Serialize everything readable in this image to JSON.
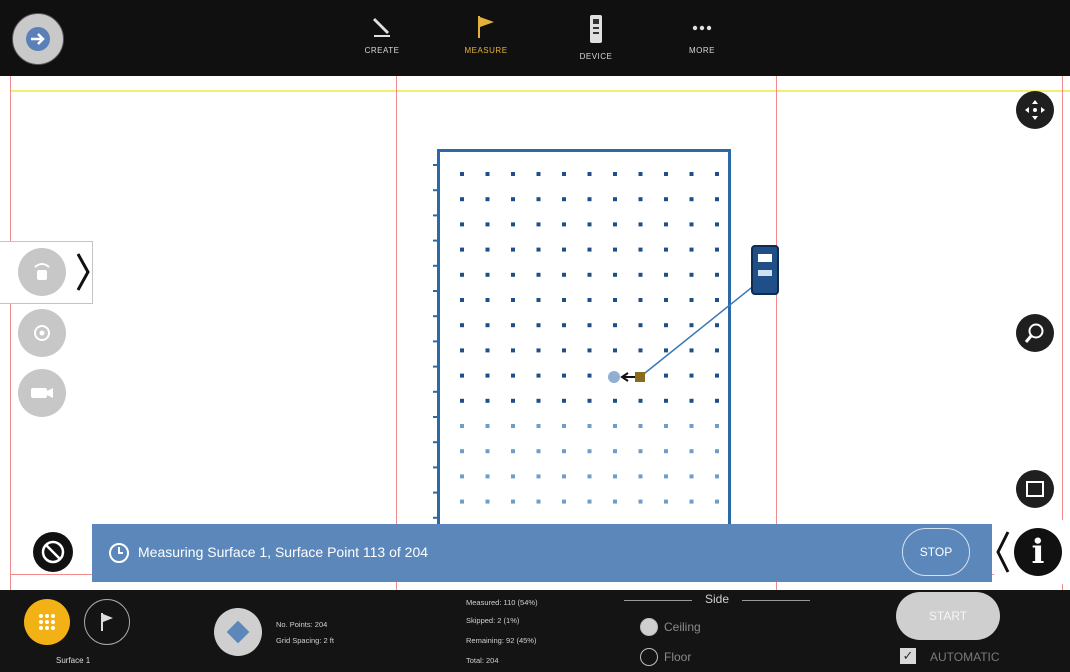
{
  "toolbar": {
    "tools": [
      {
        "label": "CREATE",
        "icon": "pencil-icon"
      },
      {
        "label": "MEASURE",
        "icon": "flag-icon",
        "active": true
      },
      {
        "label": "DEVICE",
        "icon": "device-icon"
      },
      {
        "label": "MORE",
        "icon": "more-icon"
      }
    ]
  },
  "status": {
    "message": "Measuring Surface 1, Surface Point 113 of 204",
    "stop_label": "STOP"
  },
  "bottom": {
    "surface_name": "Surface 1",
    "no_points": "No. Points: 204",
    "grid_spacing": "Grid Spacing: 2 ft",
    "measured": "Measured: 110 (54%)",
    "skipped": "Skipped: 2 (1%)",
    "remaining": "Remaining: 92 (45%)",
    "total": "Total: 204",
    "side_title": "Side",
    "side_options": [
      "Ceiling",
      "Floor"
    ],
    "side_selected": "Ceiling",
    "start_label": "START",
    "automatic_label": "AUTOMATIC",
    "automatic_checked": true
  },
  "colors": {
    "accent": "#e3b23c",
    "status_bar": "#5b87bb",
    "surface_border": "#2c6aa5",
    "point_measured": "#1f4f86",
    "point_remaining": "#6f9cc9",
    "wall_line": "#f08c8c"
  }
}
